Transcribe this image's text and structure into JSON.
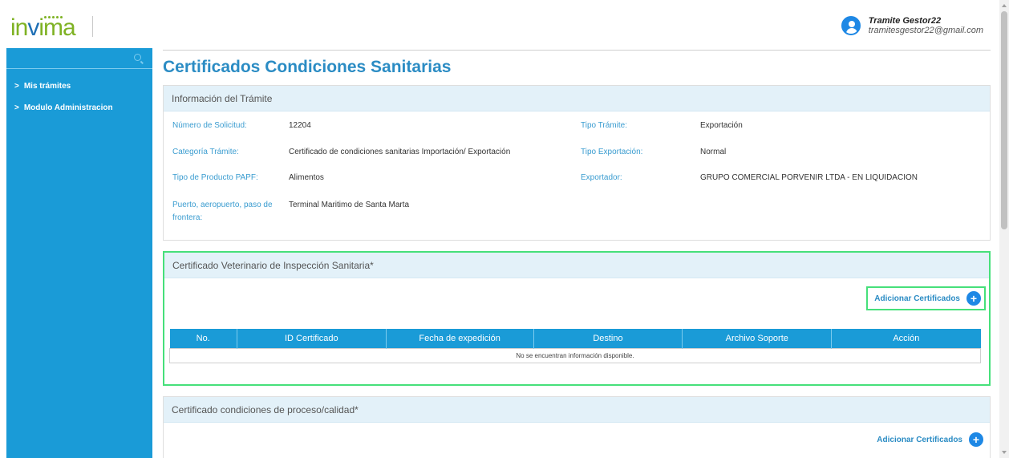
{
  "header": {
    "logo_text": "invima",
    "user_name": "Tramite Gestor22",
    "user_email": "tramitesgestor22@gmail.com"
  },
  "sidebar": {
    "items": [
      {
        "label": "Mis trámites"
      },
      {
        "label": "Modulo Administracion"
      }
    ]
  },
  "main": {
    "title": "Certificados Condiciones Sanitarias",
    "info_panel": {
      "heading": "Información del Trámite",
      "fields": {
        "numero_label": "Número de Solicitud:",
        "numero_value": "12204",
        "tipo_tramite_label": "Tipo Trámite:",
        "tipo_tramite_value": "Exportación",
        "categoria_label": "Categoría Trámite:",
        "categoria_value": "Certificado de condiciones sanitarias Importación/ Exportación",
        "tipo_exportacion_label": "Tipo Exportación:",
        "tipo_exportacion_value": "Normal",
        "tipo_producto_label": "Tipo de Producto PAPF:",
        "tipo_producto_value": "Alimentos",
        "exportador_label": "Exportador:",
        "exportador_value": "GRUPO COMERCIAL PORVENIR LTDA - EN LIQUIDACION",
        "puerto_label_1": "Puerto, aeropuerto, paso de",
        "puerto_label_2": "frontera:",
        "puerto_value": "Terminal Maritimo de Santa Marta"
      }
    },
    "vet_panel": {
      "heading": "Certificado Veterinario de Inspección Sanitaria*",
      "add_label": "Adicionar Certificados",
      "columns": [
        "No.",
        "ID Certificado",
        "Fecha de expedición",
        "Destino",
        "Archivo Soporte",
        "Acción"
      ],
      "empty_message": "No se encuentran información disponible."
    },
    "process_panel": {
      "heading": "Certificado condiciones de proceso/calidad*",
      "add_label": "Adicionar Certificados"
    }
  }
}
